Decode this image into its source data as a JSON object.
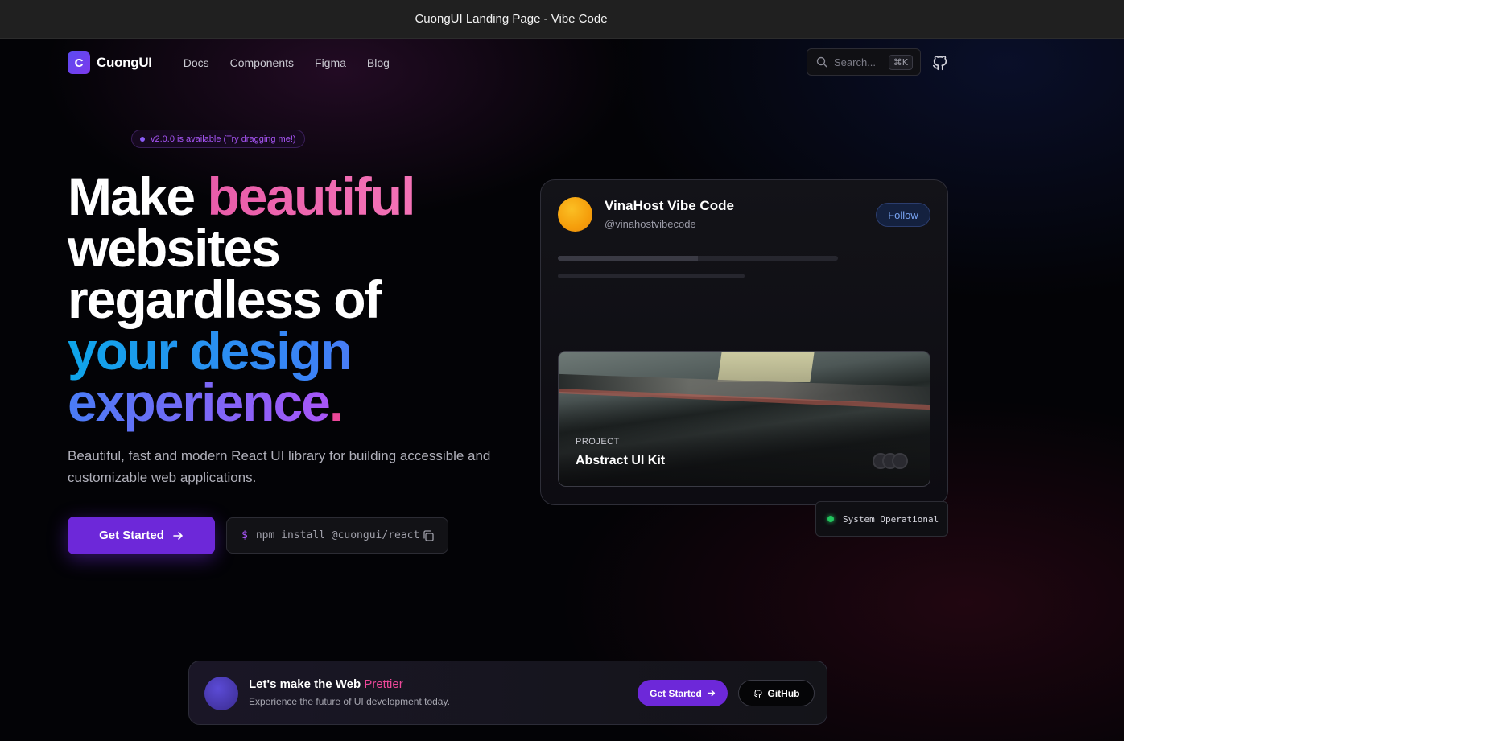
{
  "window": {
    "title": "CuongUI Landing Page - Vibe Code"
  },
  "nav": {
    "logo_letter": "C",
    "brand": "CuongUI",
    "links": [
      "Docs",
      "Components",
      "Figma",
      "Blog"
    ],
    "search_placeholder": "Search...",
    "search_shortcut": "⌘K"
  },
  "hero": {
    "badge": "v2.0.0 is available (Try dragging me!)",
    "headline": {
      "part1": "Make ",
      "part2": "beautiful",
      "part3": "websites regardless of",
      "part4": "your design experience",
      "part5": "."
    },
    "subtext": "Beautiful, fast and modern React UI library for building accessible and customizable web applications.",
    "cta_label": "Get Started",
    "npm_prompt": "$",
    "npm_command": "npm install @cuongui/react"
  },
  "profile_card": {
    "name": "VinaHost Vibe Code",
    "handle": "@vinahostvibecode",
    "follow_label": "Follow",
    "progress_fraction": 0.5,
    "project_label": "PROJECT",
    "project_title": "Abstract UI Kit",
    "status_text": "System Operational"
  },
  "banner": {
    "title_main": "Let's make the Web ",
    "title_accent": "Prettier",
    "subtitle": "Experience the future of UI development today.",
    "cta_label": "Get Started",
    "github_label": "GitHub"
  },
  "colors": {
    "accent": "#6d28d9",
    "pink": "#ec4899",
    "status_green": "#22c55e",
    "follow_text": "#79a4f2"
  },
  "icons": [
    "search-icon",
    "github-icon",
    "arrow-right-icon",
    "copy-icon"
  ]
}
